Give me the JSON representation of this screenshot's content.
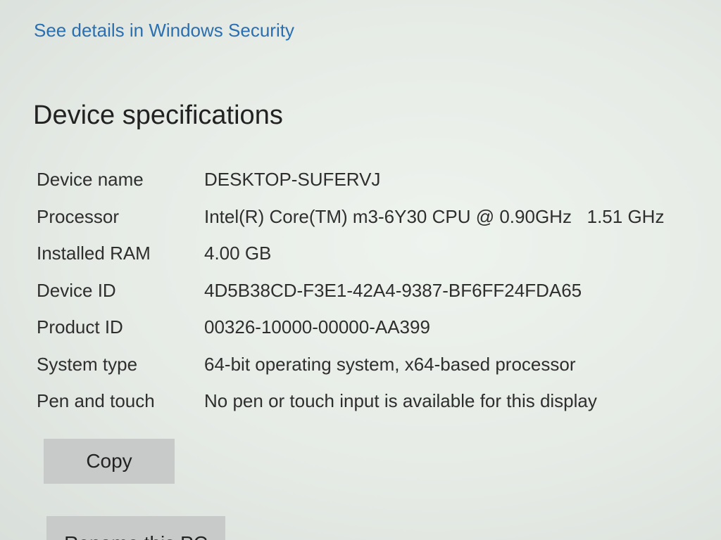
{
  "security": {
    "link_label": "See details in Windows Security"
  },
  "device_specs": {
    "title": "Device specifications",
    "rows": [
      {
        "label": "Device name",
        "value": "DESKTOP-SUFERVJ"
      },
      {
        "label": "Processor",
        "value": "Intel(R) Core(TM) m3-6Y30 CPU @ 0.90GHz   1.51 GHz"
      },
      {
        "label": "Installed RAM",
        "value": "4.00 GB"
      },
      {
        "label": "Device ID",
        "value": "4D5B38CD-F3E1-42A4-9387-BF6FF24FDA65"
      },
      {
        "label": "Product ID",
        "value": "00326-10000-00000-AA399"
      },
      {
        "label": "System type",
        "value": "64-bit operating system, x64-based processor"
      },
      {
        "label": "Pen and touch",
        "value": "No pen or touch input is available for this display"
      }
    ],
    "copy_label": "Copy",
    "rename_label": "Rename this PC"
  }
}
